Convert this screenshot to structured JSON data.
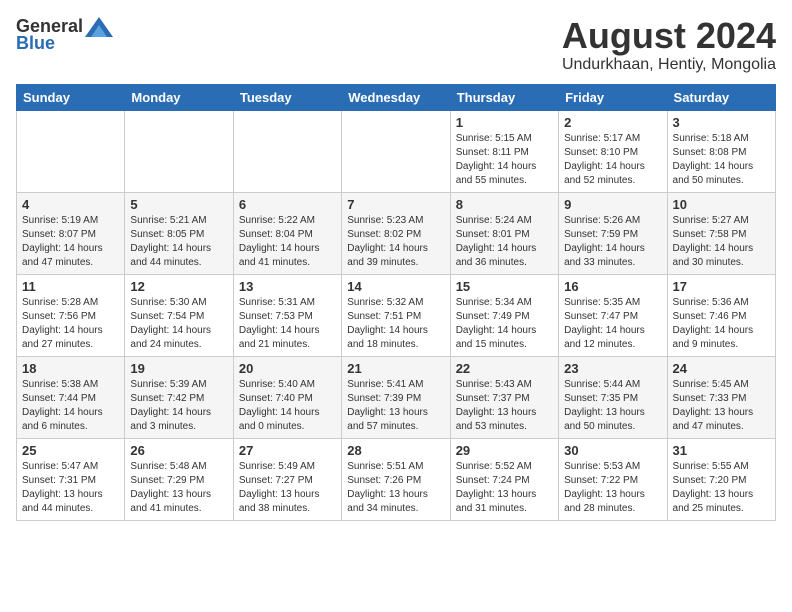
{
  "logo": {
    "general": "General",
    "blue": "Blue"
  },
  "header": {
    "month": "August 2024",
    "location": "Undurkhaan, Hentiy, Mongolia"
  },
  "weekdays": [
    "Sunday",
    "Monday",
    "Tuesday",
    "Wednesday",
    "Thursday",
    "Friday",
    "Saturday"
  ],
  "weeks": [
    [
      {
        "day": "",
        "info": ""
      },
      {
        "day": "",
        "info": ""
      },
      {
        "day": "",
        "info": ""
      },
      {
        "day": "",
        "info": ""
      },
      {
        "day": "1",
        "info": "Sunrise: 5:15 AM\nSunset: 8:11 PM\nDaylight: 14 hours\nand 55 minutes."
      },
      {
        "day": "2",
        "info": "Sunrise: 5:17 AM\nSunset: 8:10 PM\nDaylight: 14 hours\nand 52 minutes."
      },
      {
        "day": "3",
        "info": "Sunrise: 5:18 AM\nSunset: 8:08 PM\nDaylight: 14 hours\nand 50 minutes."
      }
    ],
    [
      {
        "day": "4",
        "info": "Sunrise: 5:19 AM\nSunset: 8:07 PM\nDaylight: 14 hours\nand 47 minutes."
      },
      {
        "day": "5",
        "info": "Sunrise: 5:21 AM\nSunset: 8:05 PM\nDaylight: 14 hours\nand 44 minutes."
      },
      {
        "day": "6",
        "info": "Sunrise: 5:22 AM\nSunset: 8:04 PM\nDaylight: 14 hours\nand 41 minutes."
      },
      {
        "day": "7",
        "info": "Sunrise: 5:23 AM\nSunset: 8:02 PM\nDaylight: 14 hours\nand 39 minutes."
      },
      {
        "day": "8",
        "info": "Sunrise: 5:24 AM\nSunset: 8:01 PM\nDaylight: 14 hours\nand 36 minutes."
      },
      {
        "day": "9",
        "info": "Sunrise: 5:26 AM\nSunset: 7:59 PM\nDaylight: 14 hours\nand 33 minutes."
      },
      {
        "day": "10",
        "info": "Sunrise: 5:27 AM\nSunset: 7:58 PM\nDaylight: 14 hours\nand 30 minutes."
      }
    ],
    [
      {
        "day": "11",
        "info": "Sunrise: 5:28 AM\nSunset: 7:56 PM\nDaylight: 14 hours\nand 27 minutes."
      },
      {
        "day": "12",
        "info": "Sunrise: 5:30 AM\nSunset: 7:54 PM\nDaylight: 14 hours\nand 24 minutes."
      },
      {
        "day": "13",
        "info": "Sunrise: 5:31 AM\nSunset: 7:53 PM\nDaylight: 14 hours\nand 21 minutes."
      },
      {
        "day": "14",
        "info": "Sunrise: 5:32 AM\nSunset: 7:51 PM\nDaylight: 14 hours\nand 18 minutes."
      },
      {
        "day": "15",
        "info": "Sunrise: 5:34 AM\nSunset: 7:49 PM\nDaylight: 14 hours\nand 15 minutes."
      },
      {
        "day": "16",
        "info": "Sunrise: 5:35 AM\nSunset: 7:47 PM\nDaylight: 14 hours\nand 12 minutes."
      },
      {
        "day": "17",
        "info": "Sunrise: 5:36 AM\nSunset: 7:46 PM\nDaylight: 14 hours\nand 9 minutes."
      }
    ],
    [
      {
        "day": "18",
        "info": "Sunrise: 5:38 AM\nSunset: 7:44 PM\nDaylight: 14 hours\nand 6 minutes."
      },
      {
        "day": "19",
        "info": "Sunrise: 5:39 AM\nSunset: 7:42 PM\nDaylight: 14 hours\nand 3 minutes."
      },
      {
        "day": "20",
        "info": "Sunrise: 5:40 AM\nSunset: 7:40 PM\nDaylight: 14 hours\nand 0 minutes."
      },
      {
        "day": "21",
        "info": "Sunrise: 5:41 AM\nSunset: 7:39 PM\nDaylight: 13 hours\nand 57 minutes."
      },
      {
        "day": "22",
        "info": "Sunrise: 5:43 AM\nSunset: 7:37 PM\nDaylight: 13 hours\nand 53 minutes."
      },
      {
        "day": "23",
        "info": "Sunrise: 5:44 AM\nSunset: 7:35 PM\nDaylight: 13 hours\nand 50 minutes."
      },
      {
        "day": "24",
        "info": "Sunrise: 5:45 AM\nSunset: 7:33 PM\nDaylight: 13 hours\nand 47 minutes."
      }
    ],
    [
      {
        "day": "25",
        "info": "Sunrise: 5:47 AM\nSunset: 7:31 PM\nDaylight: 13 hours\nand 44 minutes."
      },
      {
        "day": "26",
        "info": "Sunrise: 5:48 AM\nSunset: 7:29 PM\nDaylight: 13 hours\nand 41 minutes."
      },
      {
        "day": "27",
        "info": "Sunrise: 5:49 AM\nSunset: 7:27 PM\nDaylight: 13 hours\nand 38 minutes."
      },
      {
        "day": "28",
        "info": "Sunrise: 5:51 AM\nSunset: 7:26 PM\nDaylight: 13 hours\nand 34 minutes."
      },
      {
        "day": "29",
        "info": "Sunrise: 5:52 AM\nSunset: 7:24 PM\nDaylight: 13 hours\nand 31 minutes."
      },
      {
        "day": "30",
        "info": "Sunrise: 5:53 AM\nSunset: 7:22 PM\nDaylight: 13 hours\nand 28 minutes."
      },
      {
        "day": "31",
        "info": "Sunrise: 5:55 AM\nSunset: 7:20 PM\nDaylight: 13 hours\nand 25 minutes."
      }
    ]
  ]
}
